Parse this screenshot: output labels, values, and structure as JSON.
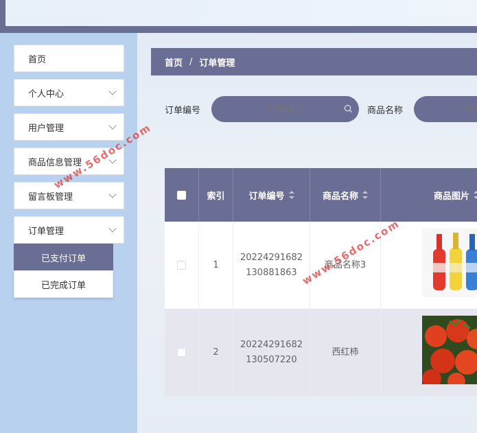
{
  "breadcrumb": {
    "home": "首页",
    "separator": "/",
    "current": "订单管理"
  },
  "sidebar": {
    "items": [
      {
        "label": "首页",
        "has_children": false
      },
      {
        "label": "个人中心",
        "has_children": true
      },
      {
        "label": "用户管理",
        "has_children": true
      },
      {
        "label": "商品信息管理",
        "has_children": true
      },
      {
        "label": "留言板管理",
        "has_children": true
      },
      {
        "label": "订单管理",
        "has_children": true
      }
    ],
    "submenu": [
      {
        "label": "已支付订单",
        "active": true
      },
      {
        "label": "已完成订单",
        "active": false
      }
    ]
  },
  "search": {
    "order_no_label": "订单编号",
    "order_no_placeholder": "订单编号",
    "product_name_label": "商品名称",
    "product_name_placeholder": "商品名称"
  },
  "table": {
    "headers": [
      "索引",
      "订单编号",
      "商品名称",
      "商品图片"
    ],
    "rows": [
      {
        "index": "1",
        "order_no_line1": "20224291682",
        "order_no_line2": "130881863",
        "product_name": "商品名称3",
        "image": "bottles-image"
      },
      {
        "index": "2",
        "order_no_line1": "20224291682",
        "order_no_line2": "130507220",
        "product_name": "西红柿",
        "image": "tomatoes-image"
      }
    ]
  },
  "watermark": "www.56doc.com",
  "colors": {
    "accent": "#6b6e94",
    "sidebar_bg": "#b7d1ee",
    "watermark": "#e03a3a"
  }
}
